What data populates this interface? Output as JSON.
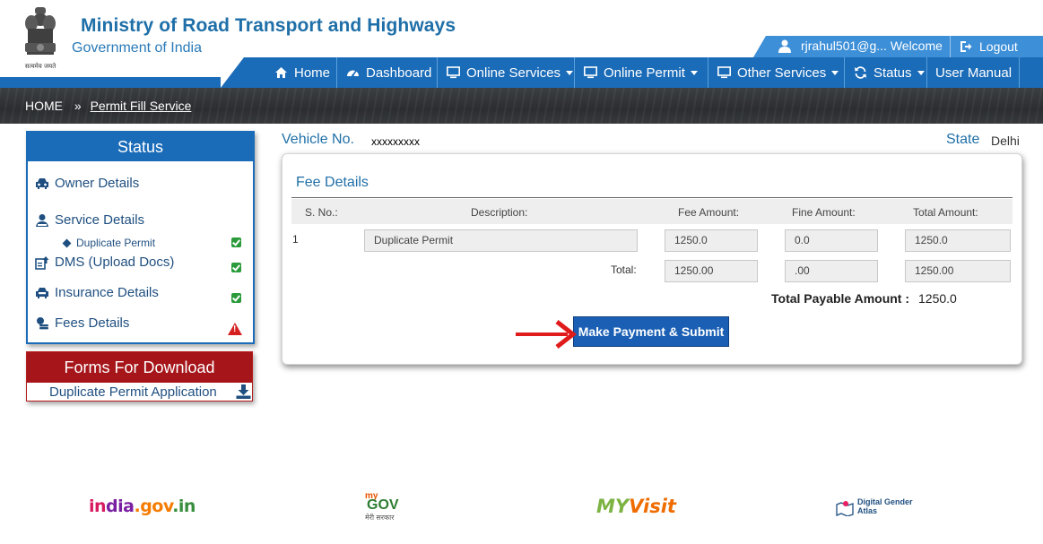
{
  "header": {
    "title": "Ministry of Road Transport and Highways",
    "subtitle": "Government of India",
    "emblem_motto": "सत्यमेव जयते",
    "user_label": "rjrahul501@g... Welcome",
    "logout_label": "Logout"
  },
  "nav": {
    "items": [
      {
        "label": "Home",
        "icon": "home-icon"
      },
      {
        "label": "Dashboard",
        "icon": "dashboard-icon"
      },
      {
        "label": "Online Services",
        "icon": "monitor-icon",
        "dropdown": true
      },
      {
        "label": "Online Permit",
        "icon": "monitor-icon",
        "dropdown": true
      },
      {
        "label": "Other Services",
        "icon": "monitor-icon",
        "dropdown": true
      },
      {
        "label": "Status",
        "icon": "refresh-icon",
        "dropdown": true
      },
      {
        "label": "User Manual"
      }
    ]
  },
  "breadcrumb": {
    "home": "HOME",
    "separator": "»",
    "current": "Permit Fill Service"
  },
  "status_panel": {
    "title": "Status",
    "items": [
      {
        "label": "Owner Details",
        "icon": "car-icon",
        "state": "none"
      },
      {
        "label": "Service Details",
        "icon": "service-icon",
        "state": "none"
      },
      {
        "label": "Duplicate Permit",
        "state": "complete"
      },
      {
        "label": "DMS (Upload Docs)",
        "icon": "upload-icon",
        "state": "complete"
      },
      {
        "label": "Insurance Details",
        "icon": "insurance-icon",
        "state": "complete"
      },
      {
        "label": "Fees Details",
        "icon": "coins-icon",
        "state": "warning"
      }
    ]
  },
  "forms_panel": {
    "title": "Forms For Download",
    "link": "Duplicate Permit Application"
  },
  "vehicle": {
    "label": "Vehicle No.",
    "value": "xxxxxxxxx",
    "state_label": "State",
    "state_value": "Delhi"
  },
  "fee_details": {
    "title": "Fee Details",
    "columns": [
      "S. No.:",
      "Description:",
      "Fee Amount:",
      "Fine Amount:",
      "Total Amount:"
    ],
    "rows": [
      {
        "sno": "1",
        "description": "Duplicate Permit",
        "fee": "1250.0",
        "fine": "0.0",
        "total": "1250.0"
      }
    ],
    "total_label": "Total:",
    "totals": {
      "fee": "1250.00",
      "fine": ".00",
      "total": "1250.00"
    },
    "payable_label": "Total Payable Amount :",
    "payable_value": "1250.0",
    "submit_label": "Make Payment & Submit"
  },
  "footer": {
    "logos": [
      "india.gov.in",
      "mygov",
      "MyVisit",
      "Digital Gender Atlas"
    ],
    "india_parts": [
      "in",
      "dia",
      ".gov",
      ".in"
    ],
    "mygov_my": "my",
    "mygov_gov": "GOV",
    "mygov_sub": "मेरी सरकार",
    "myvisit_a": "MY",
    "myvisit_b": "Visit",
    "atlas_line1": "Digital Gender",
    "atlas_line2": "Atlas"
  },
  "colors": {
    "primary_blue": "#1a6bb8",
    "user_strip_blue": "#3d8fd8",
    "download_red": "#a5151a",
    "complete_green": "#2a9a3a",
    "warning_red": "#d62020",
    "arrow_red": "#e01b1b"
  }
}
